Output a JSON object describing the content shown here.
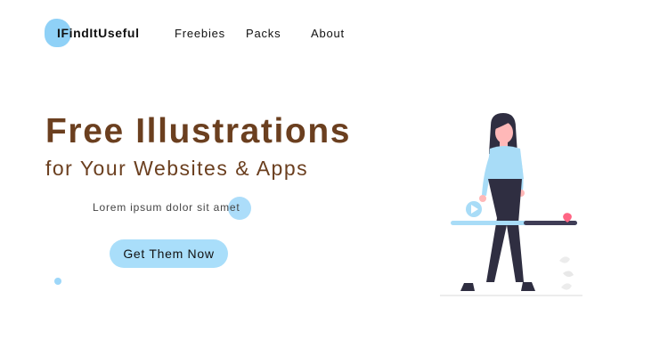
{
  "nav": {
    "logo_text": "IFindItUseful",
    "links": [
      "Freebies",
      "Packs",
      "About"
    ]
  },
  "hero": {
    "title": "Free Illustrations",
    "subtitle": "for Your Websites & Apps",
    "body": "Lorem ipsum dolor sit amet",
    "cta_label": "Get Them Now"
  },
  "colors": {
    "accent": "#8fd1f7",
    "heading": "#6b3f1f",
    "button": "#a9defa"
  },
  "icons": [
    "logo-blob-icon",
    "play-icon",
    "heart-icon",
    "person-illustration"
  ]
}
